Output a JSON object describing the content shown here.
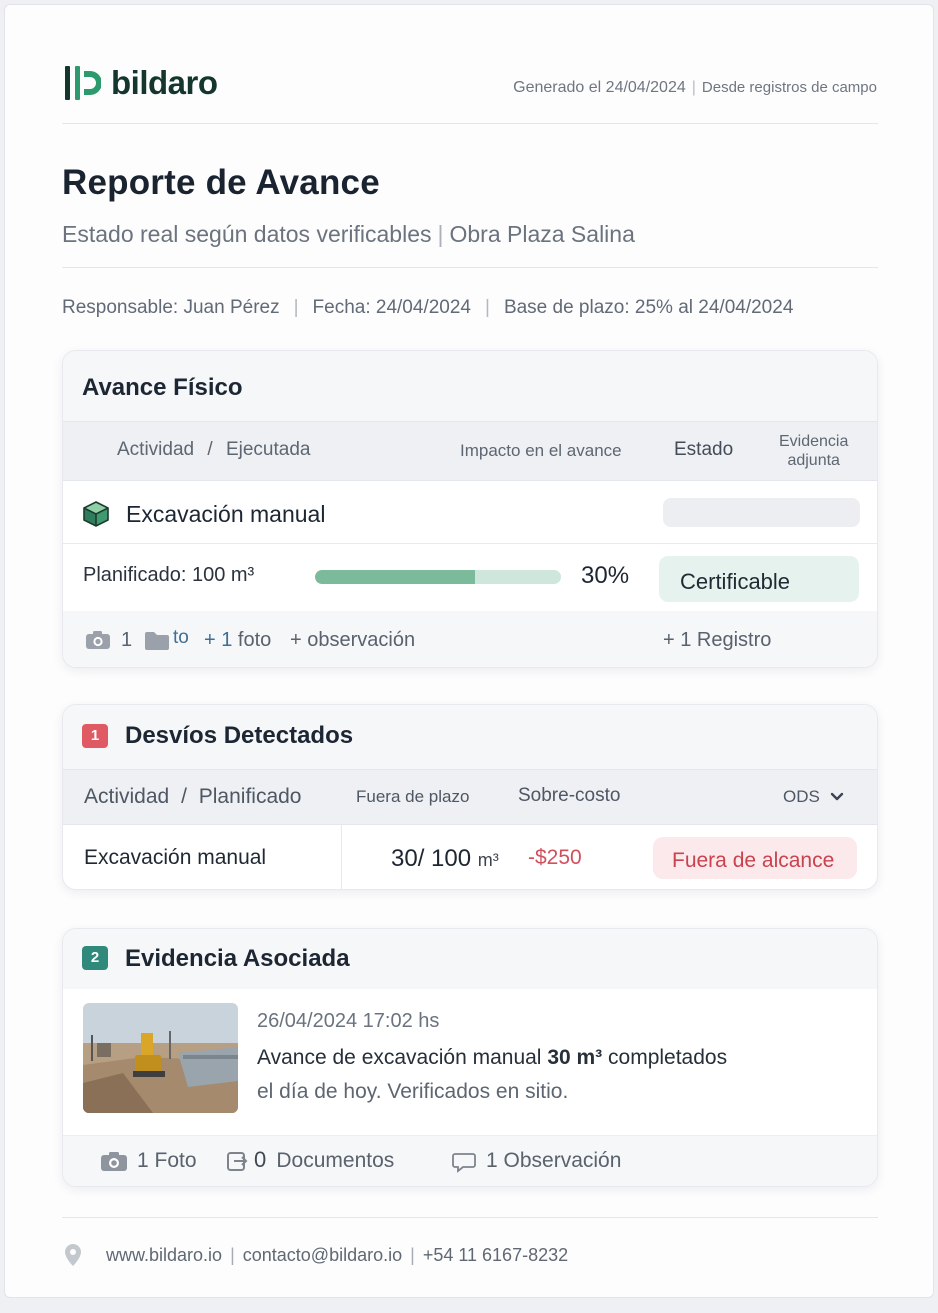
{
  "brand": {
    "name": "bildaro"
  },
  "header": {
    "generated": "Generado el 24/04/2024",
    "source": "Desde registros de campo"
  },
  "report": {
    "title": "Reporte de Avance",
    "subtitle_status": "Estado real según datos verificables",
    "subtitle_project": "Obra Plaza Salina",
    "responsible": "Responsable: Juan Pérez",
    "date": "Fecha: 24/04/2024",
    "baseline": "Base de plazo: 25% al 24/04/2024"
  },
  "physical": {
    "title": "Avance Físico",
    "columns": {
      "activity": "Actividad",
      "slash": "/",
      "executed": "Ejecutada",
      "impact": "Impacto en el avance",
      "status": "Estado",
      "evidence_1": "Evidencia",
      "evidence_2": "adjunta"
    },
    "activity_name": "Excavación manual",
    "planned": "Planificado: 100 m³",
    "progress_percent": 30,
    "progress_secondary_percent": 65,
    "progress_label": "30%",
    "status": "Certificable",
    "photo_count": "1",
    "folder_text": "to",
    "add_photo_plus": "+ 1",
    "add_photo_label": "foto",
    "add_observation": "+ observación",
    "add_record": "+ 1 Registro"
  },
  "deviations": {
    "badge": "1",
    "title": "Desvíos Detectados",
    "columns": {
      "activity": "Actividad",
      "slash": "/",
      "planned": "Planificado",
      "late": "Fuera de plazo",
      "overcost": "Sobre-costo",
      "ods": "ODS"
    },
    "row": {
      "activity": "Excavación manual",
      "quantity": "30/ 100",
      "unit": "m³",
      "cost": "-$250",
      "status": "Fuera de alcance"
    }
  },
  "evidence": {
    "badge": "2",
    "title": "Evidencia Asociada",
    "timestamp": "26/04/2024 17:02 hs",
    "text_before": "Avance de excavación manual",
    "text_bold": "30 m³",
    "text_after": "completados",
    "text_line2": "el día de hoy. Verificados en sitio.",
    "photos": "1 Foto",
    "docs_count": "0",
    "docs_label": "Documentos",
    "observations": "1 Observación"
  },
  "footer": {
    "website": "www.bildaro.io",
    "email": "contacto@bildaro.io",
    "phone": "+54 11 6167-8232"
  },
  "colors": {
    "brand_green": "#14362c",
    "progress_fill": "#7bba9b",
    "progress_track": "#cfe6dc",
    "badge_red": "#e05a63",
    "badge_teal": "#2f8a7c",
    "danger_text": "#c9434f"
  }
}
